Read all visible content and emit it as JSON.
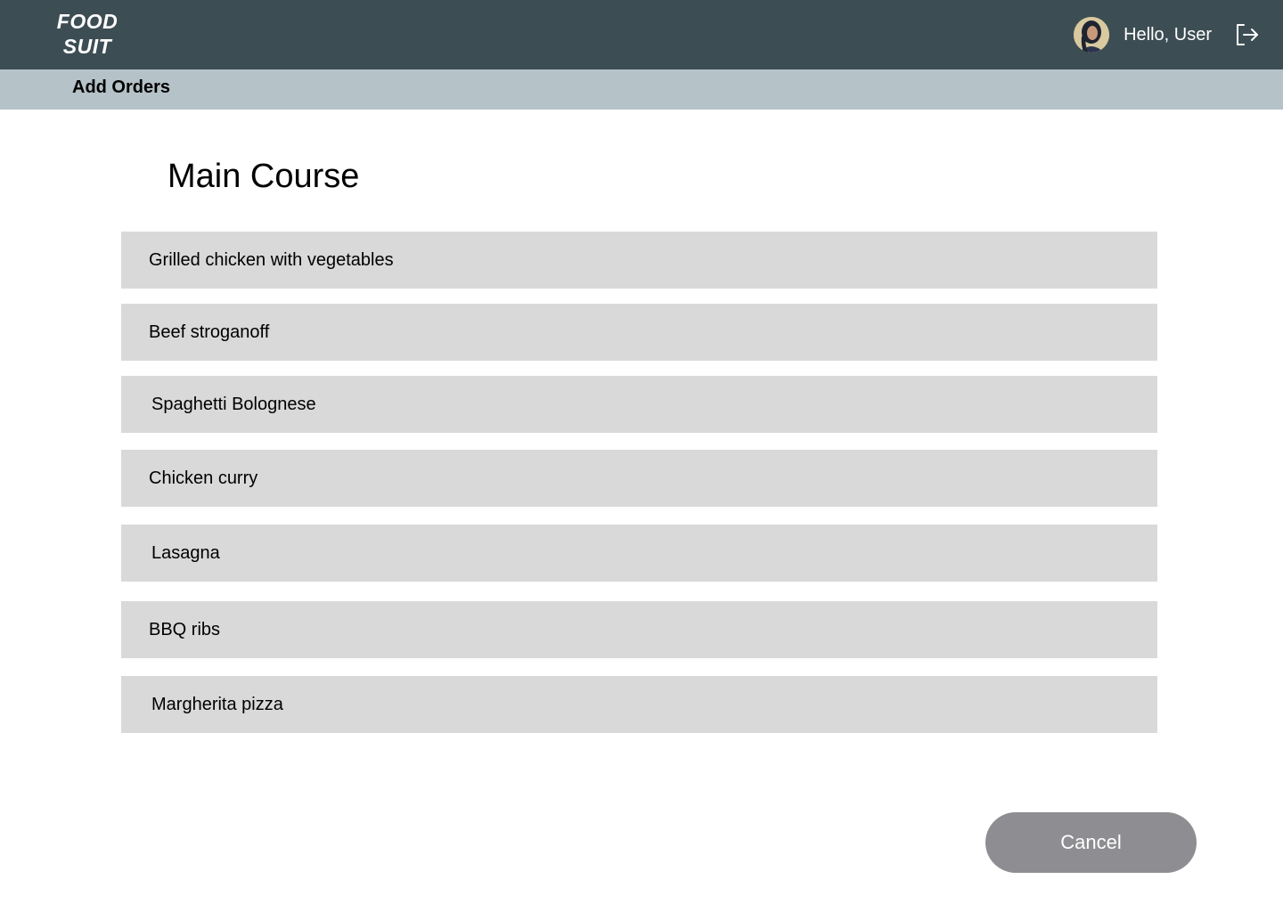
{
  "header": {
    "logo_line1": "FOOD",
    "logo_line2": "SUIT",
    "greeting": "Hello, User",
    "avatar_icon": "user-avatar",
    "logout_icon": "logout-icon",
    "background_color": "#3d4d54"
  },
  "subheader": {
    "title": "Add Orders",
    "background_color": "#b5c2c7"
  },
  "main": {
    "title": "Main Course",
    "items": [
      {
        "label": "Grilled chicken with vegetables"
      },
      {
        "label": "Beef stroganoff"
      },
      {
        "label": "Spaghetti Bolognese"
      },
      {
        "label": "Chicken curry"
      },
      {
        "label": "Lasagna"
      },
      {
        "label": "BBQ ribs"
      },
      {
        "label": "Margherita pizza"
      }
    ],
    "item_background": "#d9d9d9"
  },
  "footer": {
    "cancel_label": "Cancel",
    "cancel_color": "#8e8e92"
  }
}
